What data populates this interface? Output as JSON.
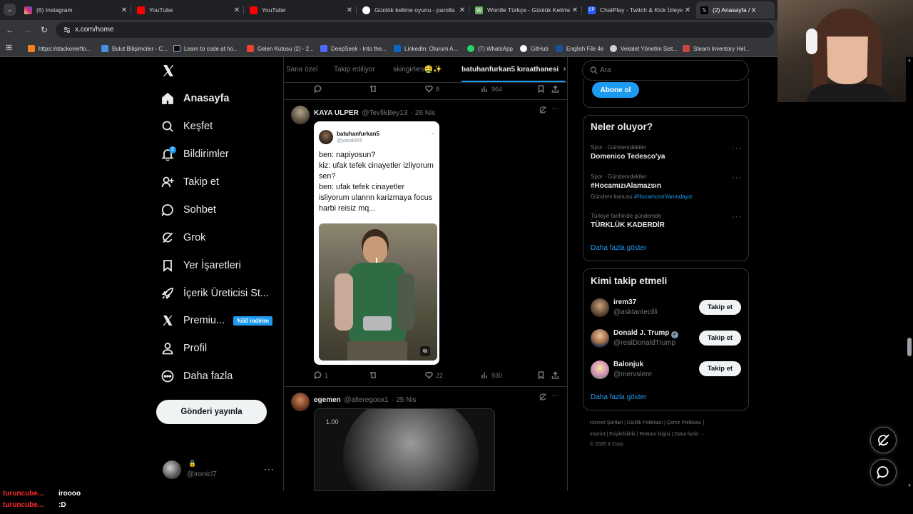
{
  "tabs": [
    {
      "title": "(6) Instagram",
      "color": "#d6249f"
    },
    {
      "title": "YouTube",
      "color": "#ff0000"
    },
    {
      "title": "YouTube",
      "color": "#ff0000"
    },
    {
      "title": "Günlük kelime oyunu - parolla",
      "color": "#ffffff"
    },
    {
      "title": "Wordle Türkçe - Günlük Kelime",
      "color": "#6aaa64"
    },
    {
      "title": "ChatPlay - Twitch & Kick İzleyic",
      "color": "#2a5cff"
    },
    {
      "title": "(2) Anasayfa / X",
      "color": "#000000"
    }
  ],
  "address": {
    "url": "x.com/home"
  },
  "bookmarks": [
    "https://stackoverflo...",
    "Bulut Bilişimciler - C...",
    "Learn to code at ho...",
    "Gelen Kutusu (2) - 2...",
    "DeepSeek - Into the...",
    "LinkedIn: Oturum A...",
    "(7) WhatsApp",
    "GitHub",
    "English File 4e",
    "Vekalet Yönetim Sist...",
    "Steam Inventory Hel..."
  ],
  "nav": {
    "home": "Anasayfa",
    "explore": "Keşfet",
    "notifications": "Bildirimler",
    "notif_count": "2",
    "follow": "Takip et",
    "chat": "Sohbet",
    "grok": "Grok",
    "bookmarks": "Yer İşaretleri",
    "creator": "İçerik Üreticisi St...",
    "premium": "Premiu...",
    "premium_badge": "%50 indirim",
    "profile": "Profil",
    "more": "Daha fazla",
    "post": "Gönderi yayınla"
  },
  "account": {
    "handle": "@ironicl7"
  },
  "feed_tabs": [
    "Sana özel",
    "Takip ediliyor",
    "skingirlies🤮✨",
    "batuhanfurkan5 kıraathanesi"
  ],
  "prev_post": {
    "likes": "8",
    "views": "964"
  },
  "post1": {
    "name": "KAYA ULPER",
    "handle": "@TevfikBey13",
    "date": "· 26 Nis",
    "embed_name": "batuhanfurkan5",
    "embed_handle": "@yasakli55",
    "embed_text": "ben: napiyosun?\nkiz: ufak tefek cinayetler izliyorum sen?\nben: ufak tefek cinayetler isliyorum ulannn karizmaya focus harbi reisiz mq...",
    "replies": "1",
    "likes": "22",
    "views": "930"
  },
  "post2": {
    "name": "egemen",
    "handle": "@alteregoox1",
    "date": "· 25 Nis",
    "media_label": "1.00"
  },
  "search": {
    "placeholder": "Ara"
  },
  "subscribe": "Abone ol",
  "trends": {
    "title": "Neler oluyor?",
    "items": [
      {
        "cat": "Spor · Gündemdekiler",
        "title": "Domenico Tedesco'ya"
      },
      {
        "cat": "Spor · Gündemdekiler",
        "title": "#HocamızıAlamazsın",
        "sub_prefix": "Gündem konusu",
        "sub_tag": "#HocamızınYanındayız"
      },
      {
        "cat": "Türkiye tarihinde gündemde",
        "title": "TÜRKLÜK KADERDİR"
      }
    ],
    "more": "Daha fazla göster"
  },
  "who_to_follow": {
    "title": "Kimi takip etmeli",
    "users": [
      {
        "name": "irem37",
        "handle": "@asktantecilli"
      },
      {
        "name": "Donald J. Trump",
        "handle": "@realDonaldTrump"
      },
      {
        "name": "Balonjuk",
        "handle": "@mervslere"
      }
    ],
    "button": "Takip et",
    "more": "Daha fazla göster"
  },
  "footer": {
    "line1": "Hizmet Şartları  |  Gizlilik Politikası  |  Çerez Politikası  |",
    "line2": "Imprint  |  Erişilebilirlik  |  Reklam bilgisi  |  Daha fazla ···",
    "line3": "© 2026 X Corp."
  },
  "chat_overlay": [
    {
      "user": "turuncube...",
      "msg": "iroooo"
    },
    {
      "user": "turuncube...",
      "msg": ":D"
    }
  ],
  "colors": {
    "accent": "#1d9bf0",
    "bg": "#000000",
    "border": "#2f3336",
    "muted": "#71767b",
    "chat_user": "#ff2a2a"
  }
}
